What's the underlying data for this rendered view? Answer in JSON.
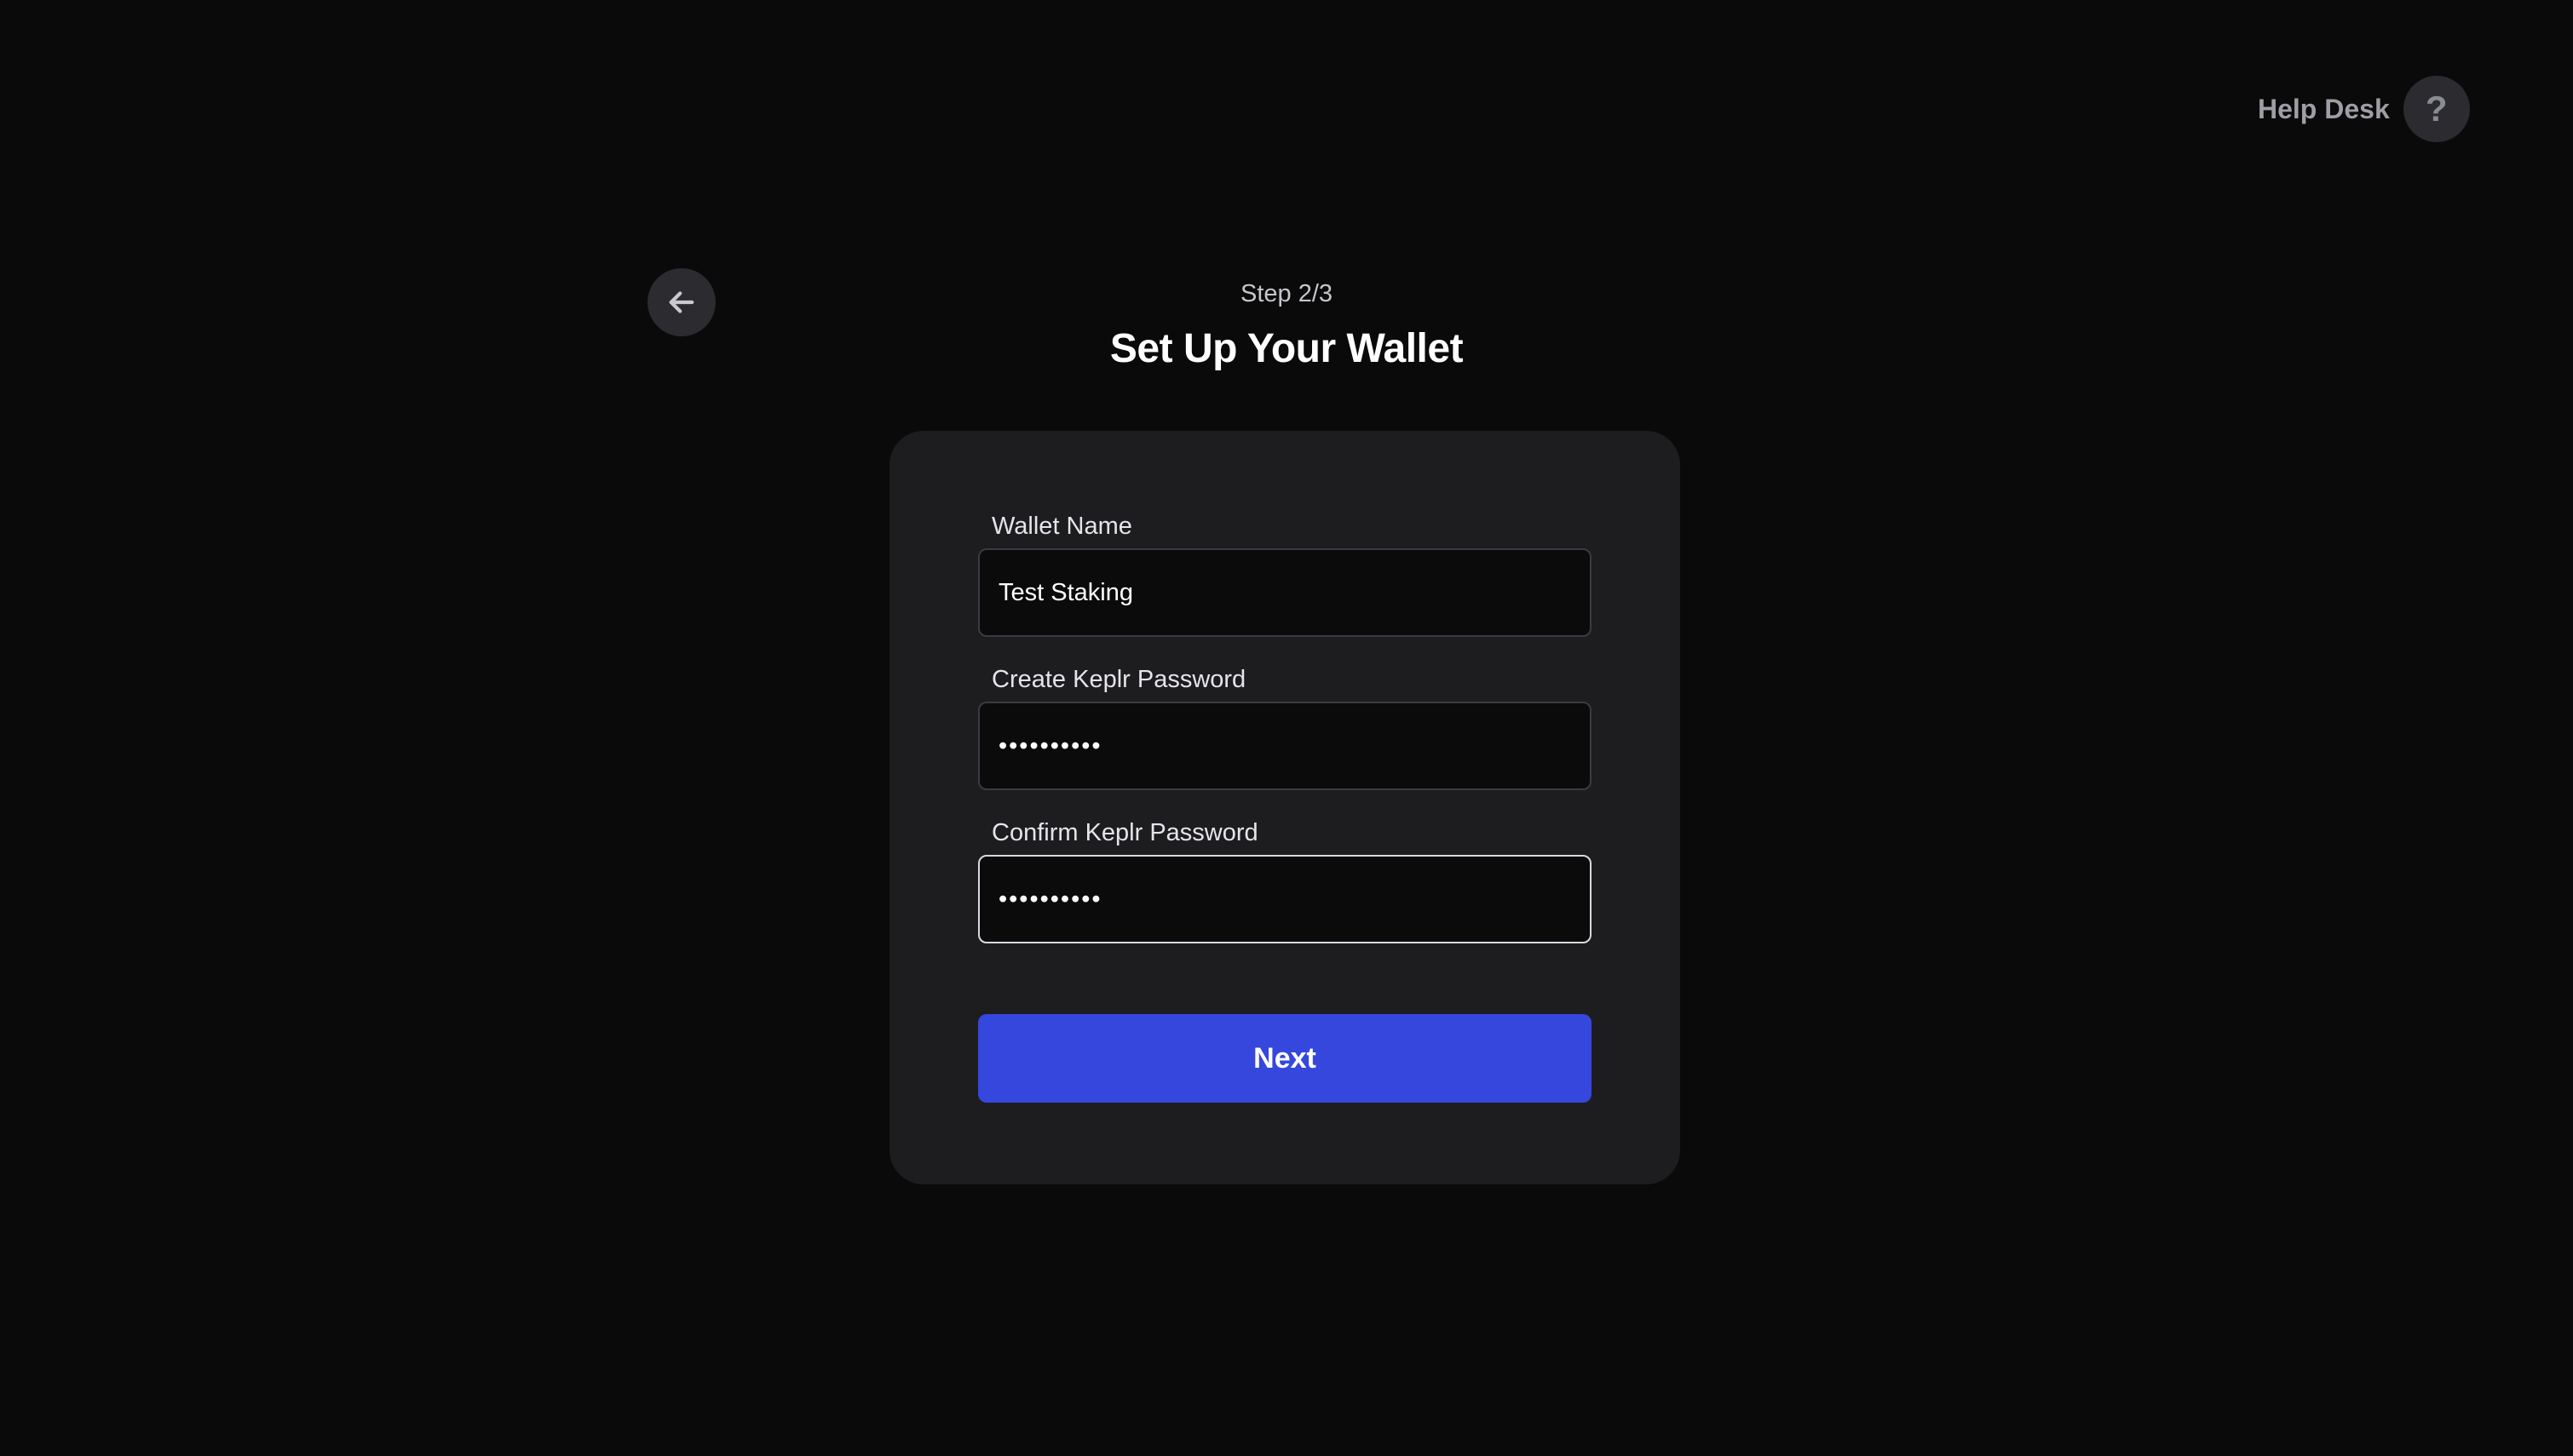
{
  "help_desk": {
    "label": "Help Desk",
    "icon": "question-icon",
    "icon_glyph": "?"
  },
  "back_button": {
    "icon": "arrow-left-icon"
  },
  "header": {
    "step": "Step 2/3",
    "title": "Set Up Your Wallet"
  },
  "form": {
    "wallet_name": {
      "label": "Wallet Name",
      "value": "Test Staking"
    },
    "password": {
      "label": "Create Keplr Password",
      "value": "••••••••••"
    },
    "confirm_password": {
      "label": "Confirm Keplr Password",
      "value": "••••••••••"
    },
    "next_label": "Next"
  },
  "colors": {
    "background": "#0a0a0a",
    "card": "#1d1d20",
    "accent": "#3547dd"
  }
}
